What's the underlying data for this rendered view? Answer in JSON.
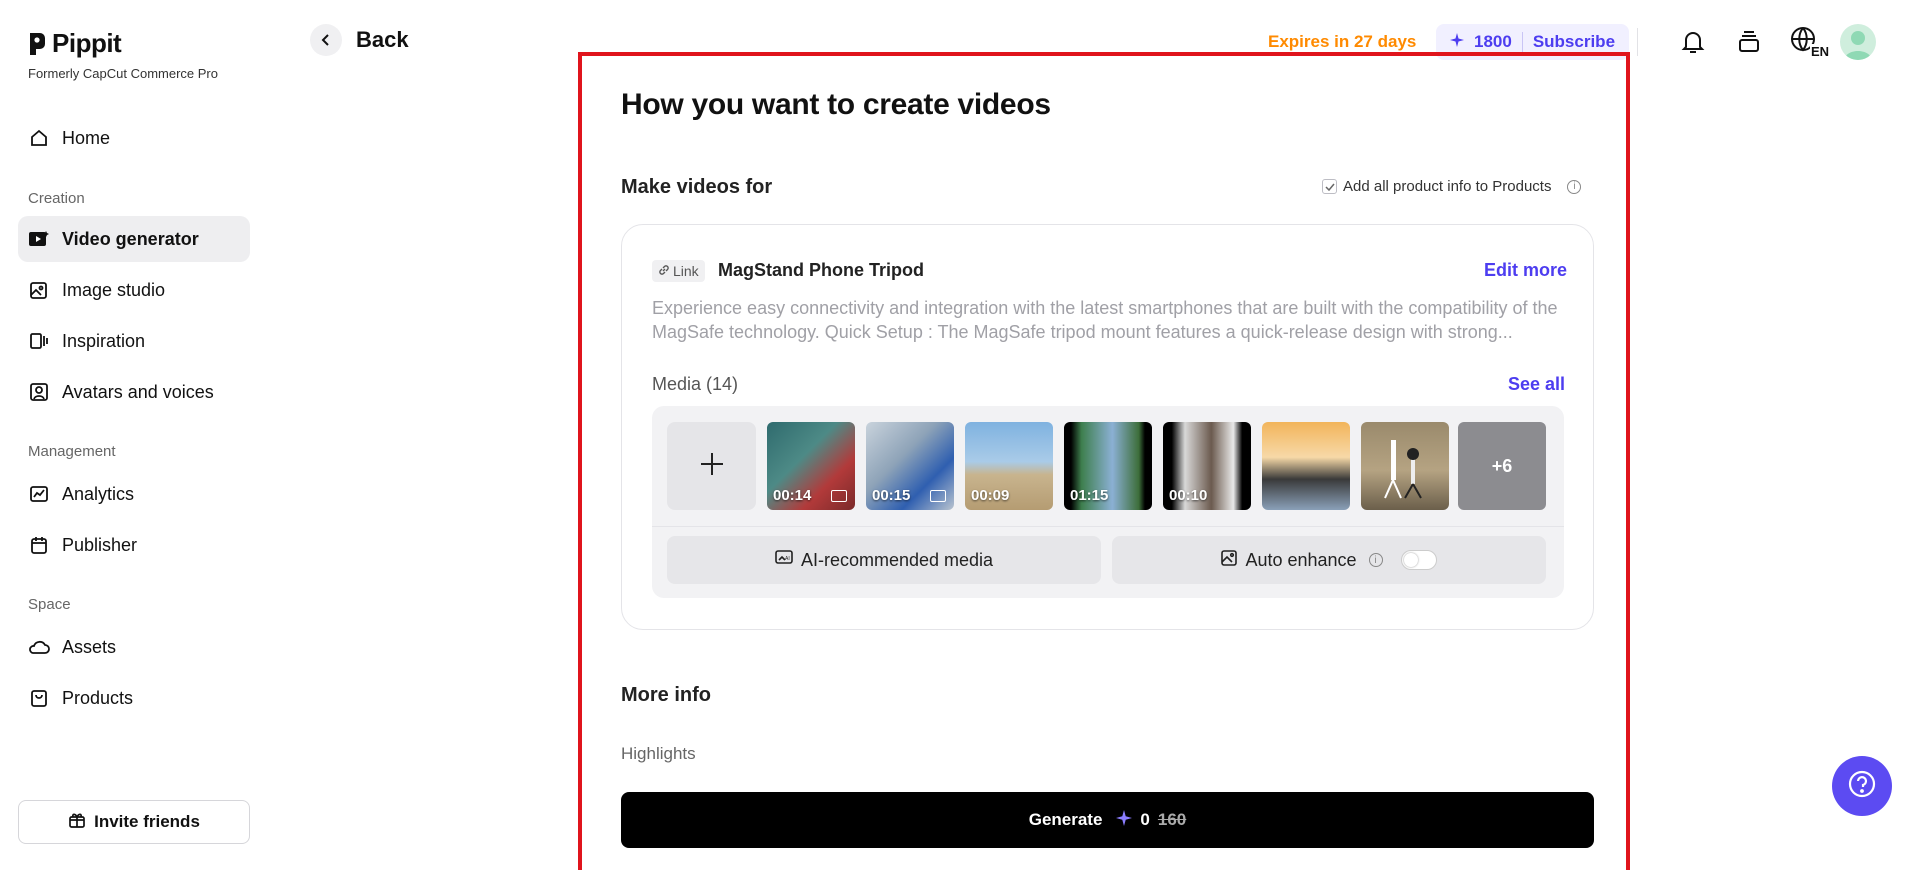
{
  "brand": {
    "name": "Pippit",
    "subtitle": "Formerly CapCut Commerce Pro"
  },
  "sidebar": {
    "items": [
      {
        "label": "Home",
        "icon": "home-icon",
        "active": false
      },
      {
        "label": "Video generator",
        "icon": "video-generator-icon",
        "active": true
      },
      {
        "label": "Image studio",
        "icon": "image-studio-icon",
        "active": false
      },
      {
        "label": "Inspiration",
        "icon": "inspiration-icon",
        "active": false
      },
      {
        "label": "Avatars and voices",
        "icon": "avatar-voice-icon",
        "active": false
      },
      {
        "label": "Analytics",
        "icon": "analytics-icon",
        "active": false
      },
      {
        "label": "Publisher",
        "icon": "calendar-icon",
        "active": false
      },
      {
        "label": "Assets",
        "icon": "cloud-icon",
        "active": false
      },
      {
        "label": "Products",
        "icon": "bag-icon",
        "active": false
      }
    ],
    "sections": {
      "creation": "Creation",
      "management": "Management",
      "space": "Space"
    },
    "invite_label": "Invite friends"
  },
  "header": {
    "back_label": "Back",
    "expires": "Expires in 27 days",
    "credits": "1800",
    "subscribe": "Subscribe",
    "language": "EN"
  },
  "main": {
    "title": "How you want to create videos",
    "make_videos_for": "Make videos for",
    "add_all_label": "Add all product info to Products",
    "product": {
      "tag": "Link",
      "name": "MagStand Phone Tripod",
      "edit_more": "Edit more",
      "description": "Experience easy connectivity and integration with the latest smartphones that are built with the compatibility of the MagSafe technology. Quick Setup : The MagSafe tripod mount features a quick-release design with strong..."
    },
    "media": {
      "label": "Media (14)",
      "see_all": "See all",
      "thumbs": [
        {
          "duration": "00:14",
          "ai": true
        },
        {
          "duration": "00:15",
          "ai": true
        },
        {
          "duration": "00:09",
          "ai": false
        },
        {
          "duration": "01:15",
          "ai": false
        },
        {
          "duration": "00:10",
          "ai": false
        },
        {
          "duration": "",
          "ai": false
        },
        {
          "duration": "",
          "ai": false
        }
      ],
      "more_count": "+6",
      "ai_recommended": "AI-recommended media",
      "auto_enhance": "Auto enhance"
    },
    "more_info": "More info",
    "highlights": "Highlights",
    "generate": {
      "label": "Generate",
      "cost": "0",
      "original_cost": "160"
    }
  },
  "colors": {
    "accent": "#4d3df0",
    "expires": "#ff8a00",
    "highlight_box": "#e0141c"
  }
}
